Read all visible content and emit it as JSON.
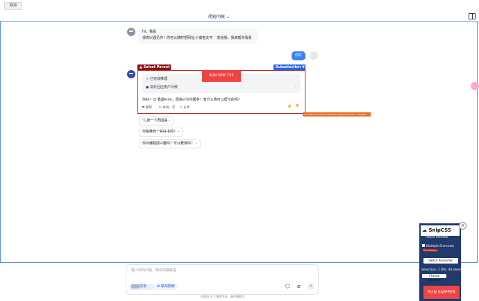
{
  "topbar": {
    "cancel_label": "取消",
    "title": "简短问候 ⌄"
  },
  "chat": {
    "greeting_line1": "Hi，我是",
    "greeting_line2": "很高兴遇见你！你可以随时把网址🔗或者文件📄发给我，我来帮你看看",
    "user_message": "你好",
    "reasoning_status": "已完成推理",
    "reasoning_item": "友好回应用户问候",
    "answer": "你好！😊 我是Kimi，很高兴为你服务！有什么我可以帮忙的吗？",
    "actions": {
      "copy": "复制",
      "retry": "再试一次",
      "share": "分享"
    },
    "suggestions": [
      "搜一下再回答",
      "你能推荐一些好书吗？",
      "你对编程感兴趣吗？可以教我吗？"
    ]
  },
  "overlay": {
    "select_parent": "▲ Select Parent",
    "subselection": "Subselection ▼",
    "run_snip_css": "RUN SNIP CSS",
    "orange_tip": "div.chat-content-item-assistant .segment-content .segment-content-box"
  },
  "composer": {
    "placeholder": "输入你的问题，帮你深度解答",
    "think_label": "思考",
    "search_label": "联网搜索"
  },
  "footer_note": "内容由 AI 大模型生成，请仔细甄别",
  "snipcss": {
    "title": "SnipCSS",
    "pause": "Pause Selector",
    "multiple": "Multiple Elements",
    "pro": "Pro Version",
    "switch_res": "Switch Resolution",
    "selection": "Selection: 1 DIV, 44 elem",
    "change_sel": "Change Selection",
    "run": "RUN SNIPPER"
  },
  "colors": {
    "accent": "#3b82f6",
    "select_parent": "#8b0d0d",
    "overlay_border": "#b91c1c",
    "run_snip": "#ef4444",
    "snip_panel": "#1f3a6b"
  }
}
